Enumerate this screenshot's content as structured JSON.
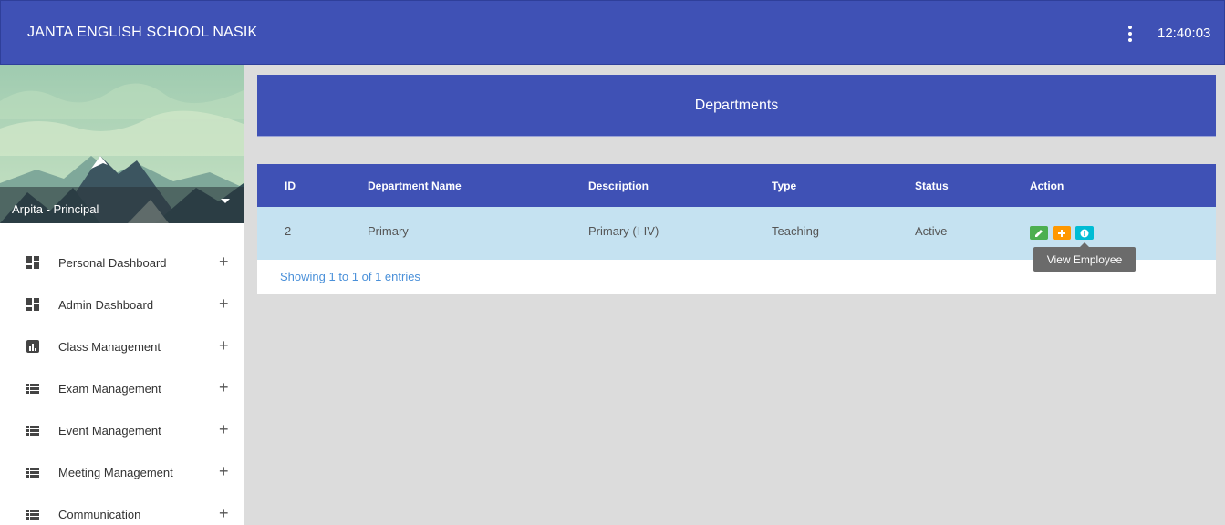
{
  "app": {
    "title": "JANTA ENGLISH SCHOOL NASIK",
    "clock": "12:40:03"
  },
  "topbar": {
    "menu_icon": "more-vert-icon"
  },
  "sidebar": {
    "profile": {
      "name": "Arpita - Principal"
    },
    "items": [
      {
        "label": "Personal Dashboard",
        "icon": "dashboard-icon"
      },
      {
        "label": "Admin Dashboard",
        "icon": "grid-icon"
      },
      {
        "label": "Class Management",
        "icon": "bar-chart-icon"
      },
      {
        "label": "Exam Management",
        "icon": "list-icon"
      },
      {
        "label": "Event Management",
        "icon": "list-icon"
      },
      {
        "label": "Meeting Management",
        "icon": "list-icon"
      },
      {
        "label": "Communication",
        "icon": "list-icon"
      }
    ],
    "expand_symbol": "+"
  },
  "page": {
    "title": "Departments"
  },
  "table": {
    "columns": [
      "ID",
      "Department Name",
      "Description",
      "Type",
      "Status",
      "Action"
    ],
    "rows": [
      {
        "id": "2",
        "name": "Primary",
        "description": "Primary (I-IV)",
        "type": "Teaching",
        "status": "Active"
      }
    ],
    "footer": "Showing 1 to 1 of 1 entries",
    "actions": [
      {
        "icon": "edit-icon",
        "color": "#4caf50"
      },
      {
        "icon": "add-icon",
        "color": "#ff9800"
      },
      {
        "icon": "info-icon",
        "color": "#00bcd4"
      }
    ]
  },
  "tooltip": {
    "text": "View Employee"
  },
  "colors": {
    "primary": "#3f51b5",
    "row_highlight": "#c5e2f1",
    "link": "#4a90d9"
  }
}
